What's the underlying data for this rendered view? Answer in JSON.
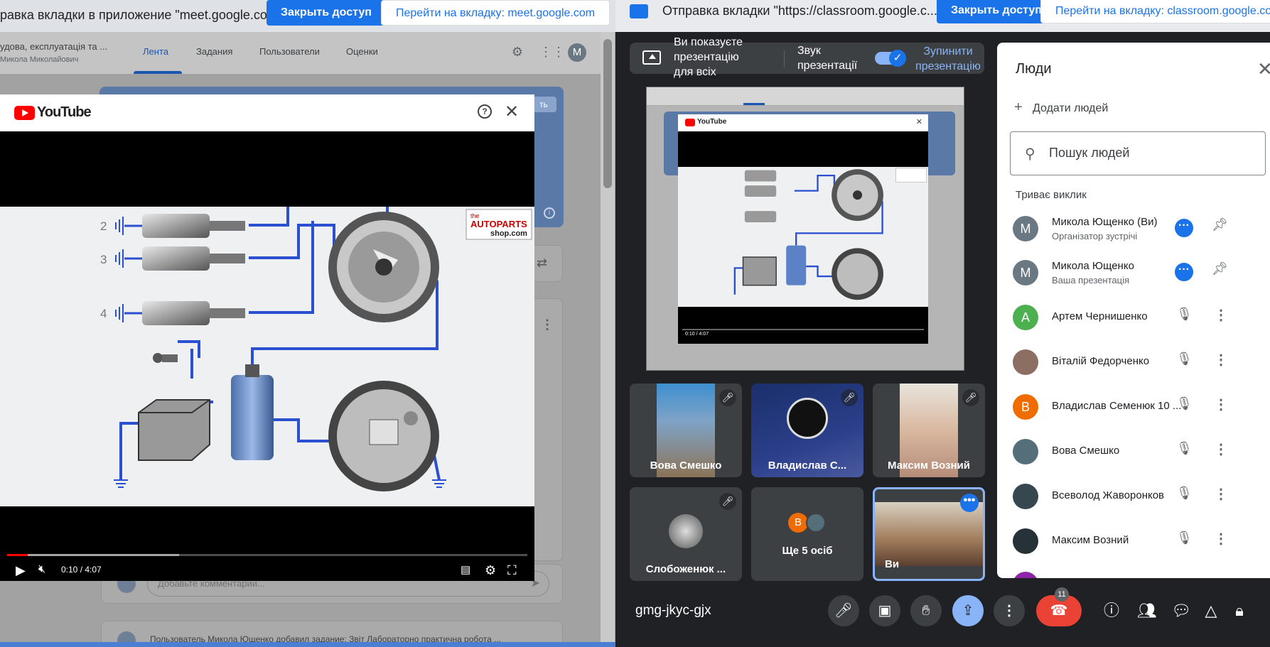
{
  "left_window": {
    "share_bar": {
      "message": "равка вкладки в приложение \"meet.google.co...",
      "stop_button": "Закрыть доступ",
      "goto_button": "Перейти на вкладку: meet.google.com"
    },
    "classroom": {
      "course_title": "удова, експлуатація та ...",
      "course_teacher": "Микола Миколайович",
      "tabs": [
        "Лента",
        "Задания",
        "Пользователи",
        "Оценки"
      ],
      "avatar_letter": "M",
      "comment_placeholder": "Добавьте комментарий...",
      "post_text": "Пользователь Микола Ющенко добавил задание: Звіт Лабораторно практична робота ...",
      "banner_button": "ть"
    },
    "youtube": {
      "brand": "YouTube",
      "time": "0:10 / 4:07",
      "watermark_line1": "the",
      "watermark_line2": "AUTOPARTS",
      "watermark_line3": "shop.com",
      "plug_labels": [
        "2",
        "3",
        "4"
      ],
      "progress_played": 0.04,
      "progress_buffered": 0.33
    }
  },
  "right_window": {
    "share_bar": {
      "message": "Отправка вкладки \"https://classroom.google.c...",
      "stop_button": "Закрыть доступ",
      "goto_button": "Перейти на вкладку: classroom.google.com"
    },
    "presenting_bar": {
      "status_line1": "Ви показуєте",
      "status_line2": "презентацію",
      "status_line3": "для всіх",
      "audio_line1": "Звук",
      "audio_line2": "презентації",
      "stop_line1": "Зупинити",
      "stop_line2": "презентацію"
    },
    "preview": {
      "yt_time": "0:10 / 4:07"
    },
    "tiles": [
      {
        "name": "Вова Смешко"
      },
      {
        "name": "Владислав С..."
      },
      {
        "name": "Максим Возний"
      },
      {
        "name": "Слобоженюк ..."
      },
      {
        "name": "Ще 5 осіб",
        "avatar_letter": "В"
      },
      {
        "name": "Ви"
      }
    ],
    "meeting_code": "gmg-jkyc-gjx",
    "participant_count": "11",
    "people_panel": {
      "title": "Люди",
      "add_people": "Додати людей",
      "search_placeholder": "Пошук людей",
      "section": "Триває виклик",
      "people": [
        {
          "letter": "M",
          "name": "Микола Ющенко (Ви)",
          "sub": "Організатор зустрічі",
          "color": "#6a7883"
        },
        {
          "letter": "M",
          "name": "Микола Ющенко",
          "sub": "Ваша презентація",
          "color": "#6a7883"
        },
        {
          "letter": "А",
          "name": "Артем Чернишенко",
          "sub": "",
          "color": "#4caf50"
        },
        {
          "letter": "",
          "name": "Віталій Федорченко",
          "sub": "",
          "color": "#8d6e63"
        },
        {
          "letter": "В",
          "name": "Владислав Семенюк 10 ...",
          "sub": "",
          "color": "#ef6c00"
        },
        {
          "letter": "",
          "name": "Вова Смешко",
          "sub": "",
          "color": "#546e7a"
        },
        {
          "letter": "",
          "name": "Всеволод Жаворонков",
          "sub": "",
          "color": "#37474f"
        },
        {
          "letter": "",
          "name": "Максим Возний",
          "sub": "",
          "color": "#263238"
        }
      ]
    }
  },
  "colors": {
    "meet_bg": "#202124",
    "blue": "#1a73e8",
    "light_blue": "#8ab4f8",
    "end_red": "#ea4335"
  }
}
